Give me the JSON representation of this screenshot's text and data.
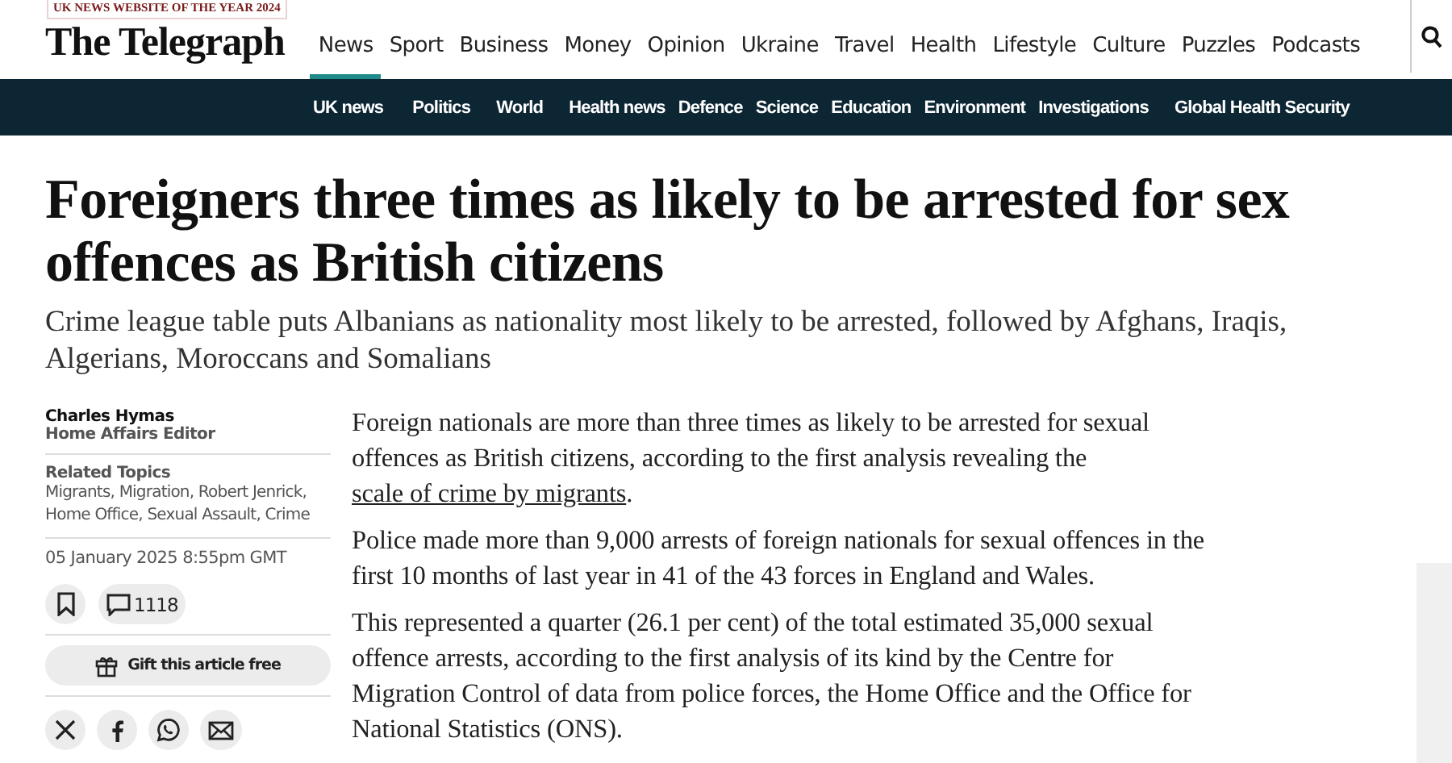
{
  "award": "UK NEWS WEBSITE OF THE YEAR 2024",
  "logo": "The Telegraph",
  "nav": [
    {
      "label": "News",
      "selected": true
    },
    {
      "label": "Sport",
      "selected": false
    },
    {
      "label": "Business",
      "selected": false
    },
    {
      "label": "Money",
      "selected": false
    },
    {
      "label": "Opinion",
      "selected": false
    },
    {
      "label": "Ukraine",
      "selected": false
    },
    {
      "label": "Travel",
      "selected": false
    },
    {
      "label": "Health",
      "selected": false
    },
    {
      "label": "Lifestyle",
      "selected": false
    },
    {
      "label": "Culture",
      "selected": false
    },
    {
      "label": "Puzzles",
      "selected": false
    },
    {
      "label": "Podcasts",
      "selected": false
    }
  ],
  "subnav": [
    "UK news",
    "Politics",
    "World",
    "Health news",
    "Defence",
    "Science",
    "Education",
    "Environment",
    "Investigations",
    "Global Health Security"
  ],
  "headline": "Foreigners three times as likely to be arrested for sex offences as British citizens",
  "standfirst": "Crime league table puts Albanians as nationality most likely to be arrested, followed by Afghans, Iraqis, Algerians, Moroccans and Somalians",
  "author": {
    "name": "Charles Hymas",
    "role": "Home Affairs Editor"
  },
  "related_topics": {
    "title": "Related Topics",
    "topics": "Migrants, Migration, Robert Jenrick, Home Office, Sexual Assault, Crime"
  },
  "date": "05 January 2025 8:55pm GMT",
  "comments": "1118",
  "gift": "Gift this article free",
  "share": [
    {
      "kind": "x"
    },
    {
      "kind": "facebook"
    },
    {
      "kind": "whatsapp"
    },
    {
      "kind": "email"
    }
  ],
  "paragraphs": [
    {
      "text": "Foreign nationals are more than three times as likely to be arrested for sexual offences as British citizens, according to the first analysis revealing the ",
      "link": "scale of crime by migrants",
      "after": "."
    },
    {
      "text": "Police made more than 9,000 arrests of foreign nationals for sexual offences in the first 10 months of last year in 41 of the 43 forces in England and Wales."
    },
    {
      "text": "This represented a quarter (26.1 per cent) of the total estimated 35,000 sexual offence arrests, according to the first analysis of its kind by the Centre for Migration Control of data from police forces, the Home Office and the Office for National Statistics (ONS)."
    }
  ]
}
